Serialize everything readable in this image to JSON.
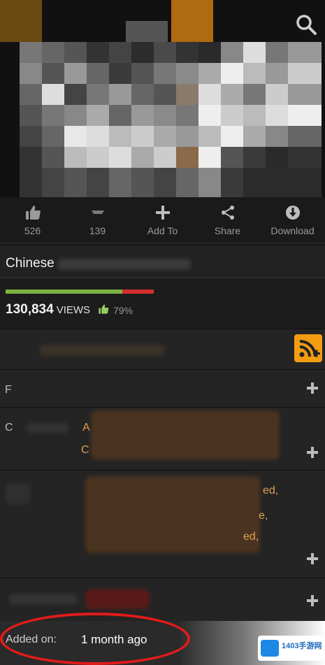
{
  "actions": {
    "like_count": "526",
    "dislike_count": "139",
    "add_to": "Add To",
    "share": "Share",
    "download": "Download"
  },
  "video": {
    "title": "Chinese"
  },
  "stats": {
    "views": "130,834",
    "views_label": "VIEWS",
    "rating": "79%",
    "rating_fraction": 0.79
  },
  "rows": {
    "row2_letter": "F",
    "row3_letter": "C",
    "row3_line1": "A",
    "row3_line2": "C",
    "row4_frag1": "ed,",
    "row4_frag2": "e,",
    "row4_frag3": "ed,"
  },
  "added": {
    "label": "Added on:",
    "value": "1 month ago"
  },
  "watermark": {
    "text": "1403手游网"
  },
  "colors": {
    "accent_orange": "#f39c12",
    "rating_green": "#7cb342",
    "rating_red": "#d32f2f",
    "annotation_red": "#e21b1b"
  }
}
